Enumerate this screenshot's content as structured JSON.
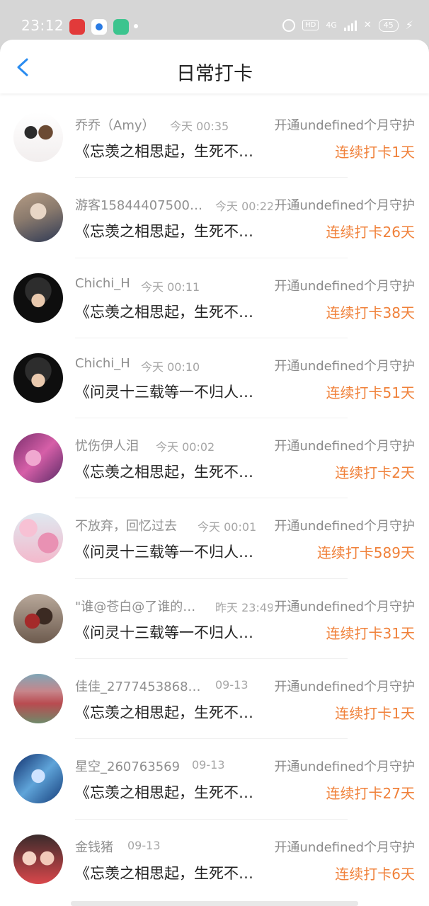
{
  "status_bar": {
    "time": "23:12",
    "hd": "HD",
    "network": "4G",
    "battery": "45",
    "colors": {
      "background": "#d6d6d6"
    }
  },
  "header": {
    "title": "日常打卡",
    "back_icon": "chevron-left-icon",
    "accent": "#2a8cf0"
  },
  "list": {
    "guard_text_color": "#8a8a8a",
    "streak_color": "#f0813a",
    "items": [
      {
        "name": "乔乔（Amy）",
        "time": "今天 00:35",
        "guard": "开通undefined个月守护",
        "message": "《忘羡之相思起，生死不…",
        "streak": "连续打卡1天"
      },
      {
        "name": "游客15844407500…",
        "time": "今天 00:22",
        "guard": "开通undefined个月守护",
        "message": "《忘羡之相思起，生死不…",
        "streak": "连续打卡26天"
      },
      {
        "name": "Chichi_H",
        "time": "今天 00:11",
        "guard": "开通undefined个月守护",
        "message": "《忘羡之相思起，生死不…",
        "streak": "连续打卡38天"
      },
      {
        "name": "Chichi_H",
        "time": "今天 00:10",
        "guard": "开通undefined个月守护",
        "message": "《问灵十三载等一不归人…",
        "streak": "连续打卡51天"
      },
      {
        "name": "忧伤伊人泪",
        "time": "今天 00:02",
        "guard": "开通undefined个月守护",
        "message": "《忘羡之相思起，生死不…",
        "streak": "连续打卡2天"
      },
      {
        "name": "不放弃，回忆过去",
        "time": "今天 00:01",
        "guard": "开通undefined个月守护",
        "message": "《问灵十三载等一不归人…",
        "streak": "连续打卡589天"
      },
      {
        "name": "\"谁@苍白@了谁的…",
        "time": "昨天 23:49",
        "guard": "开通undefined个月守护",
        "message": "《问灵十三载等一不归人…",
        "streak": "连续打卡31天"
      },
      {
        "name": "佳佳_2777453868…",
        "time": "09-13",
        "guard": "开通undefined个月守护",
        "message": "《忘羡之相思起，生死不…",
        "streak": "连续打卡1天"
      },
      {
        "name": "星空_260763569",
        "time": "09-13",
        "guard": "开通undefined个月守护",
        "message": "《忘羡之相思起，生死不…",
        "streak": "连续打卡27天"
      },
      {
        "name": "金钱猪",
        "time": "09-13",
        "guard": "开通undefined个月守护",
        "message": "《忘羡之相思起，生死不…",
        "streak": "连续打卡6天"
      }
    ]
  }
}
